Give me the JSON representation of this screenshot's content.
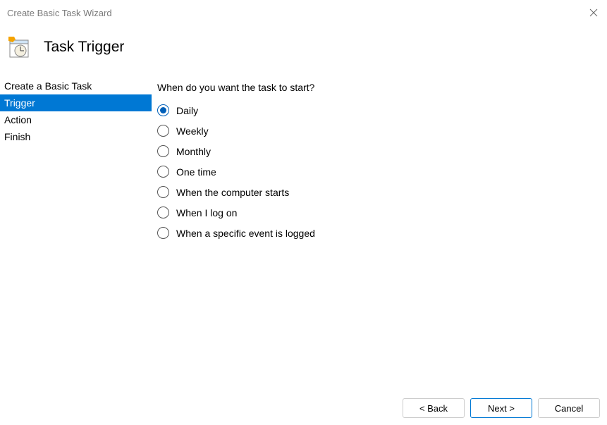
{
  "window": {
    "title": "Create Basic Task Wizard"
  },
  "header": {
    "title": "Task Trigger"
  },
  "sidebar": {
    "items": [
      {
        "label": "Create a Basic Task",
        "active": false
      },
      {
        "label": "Trigger",
        "active": true
      },
      {
        "label": "Action",
        "active": false
      },
      {
        "label": "Finish",
        "active": false
      }
    ]
  },
  "main": {
    "question": "When do you want the task to start?",
    "options": [
      {
        "label": "Daily",
        "checked": true
      },
      {
        "label": "Weekly",
        "checked": false
      },
      {
        "label": "Monthly",
        "checked": false
      },
      {
        "label": "One time",
        "checked": false
      },
      {
        "label": "When the computer starts",
        "checked": false
      },
      {
        "label": "When I log on",
        "checked": false
      },
      {
        "label": "When a specific event is logged",
        "checked": false
      }
    ]
  },
  "footer": {
    "back": "< Back",
    "next": "Next >",
    "cancel": "Cancel"
  }
}
